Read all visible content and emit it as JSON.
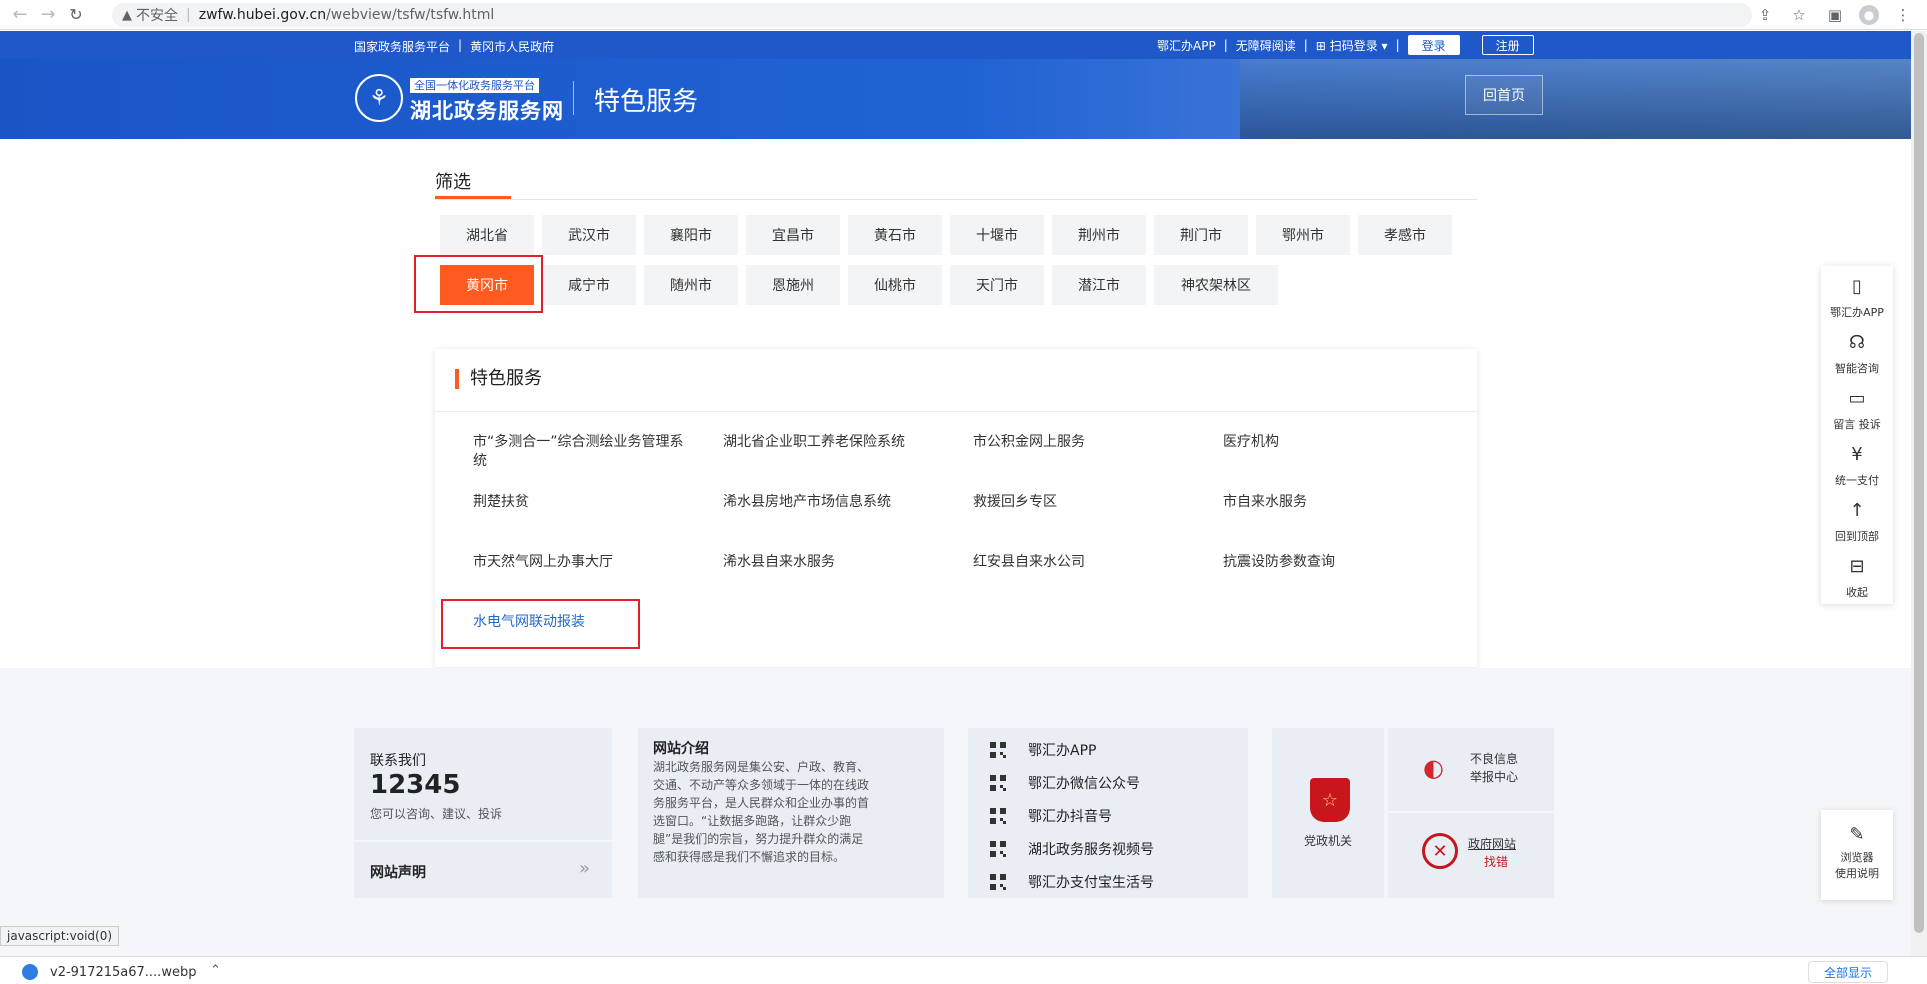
{
  "browser": {
    "insecure_label": "不安全",
    "url_host": "zwfw.hubei.gov.cn",
    "url_path": "/webview/tsfw/tsfw.html"
  },
  "topbar": {
    "links": [
      "国家政务服务平台",
      "黄冈市人民政府"
    ],
    "right": {
      "app": "鄂汇办APP",
      "accessible": "无障碍阅读",
      "scan_login": "扫码登录",
      "login": "登录",
      "register": "注册"
    }
  },
  "banner": {
    "logo_top": "全国一体化政务服务平台",
    "logo_main": "湖北政务服务网",
    "page_title": "特色服务",
    "home_button": "回首页"
  },
  "filter": {
    "heading": "筛选",
    "cities_row1": [
      "湖北省",
      "武汉市",
      "襄阳市",
      "宜昌市",
      "黄石市",
      "十堰市",
      "荆州市",
      "荆门市",
      "鄂州市",
      "孝感市"
    ],
    "cities_row2": [
      "黄冈市",
      "咸宁市",
      "随州市",
      "恩施州",
      "仙桃市",
      "天门市",
      "潜江市",
      "神农架林区"
    ],
    "active": "黄冈市"
  },
  "services": {
    "heading": "特色服务",
    "items": [
      [
        "市“多测合一”综合测绘业务管理系统",
        "湖北省企业职工养老保险系统",
        "市公积金网上服务",
        "医疗机构"
      ],
      [
        "荆楚扶贫",
        "浠水县房地产市场信息系统",
        "救援回乡专区",
        "市自来水服务"
      ],
      [
        "市天然气网上办事大厅",
        "浠水县自来水服务",
        "红安县自来水公司",
        "抗震设防参数查询"
      ]
    ],
    "highlight": "水电气网联动报装"
  },
  "footer": {
    "contact_title": "联系我们",
    "contact_number": "12345",
    "contact_desc": "您可以咨询、建议、投诉",
    "declaration": "网站声明",
    "declaration_arrow": "»",
    "intro_title": "网站介绍",
    "intro_body": "湖北政务服务网是集公安、户政、教育、交通、不动产等众多领域于一体的在线政务服务平台，是人民群众和企业办事的首选窗口。“让数据多跑路，让群众少跑腿”是我们的宗旨，努力提升群众的满足感和获得感是我们不懈追求的目标。",
    "apps": [
      "鄂汇办APP",
      "鄂汇办微信公众号",
      "鄂汇办抖音号",
      "湖北政务服务视频号",
      "鄂汇办支付宝生活号"
    ],
    "party": "党政机关",
    "bad_info": [
      "不良信息",
      "举报中心"
    ],
    "gov_error": [
      "政府网站",
      "找错"
    ]
  },
  "rail": {
    "items": [
      "鄂汇办APP",
      "智能咨询",
      "留言 投诉",
      "统一支付",
      "回到顶部",
      "收起"
    ],
    "browser_guide": [
      "浏览器",
      "使用说明"
    ]
  },
  "status_text": "javascript:void(0)",
  "download": {
    "file": "v2-917215a67....webp",
    "show_all": "全部显示"
  }
}
